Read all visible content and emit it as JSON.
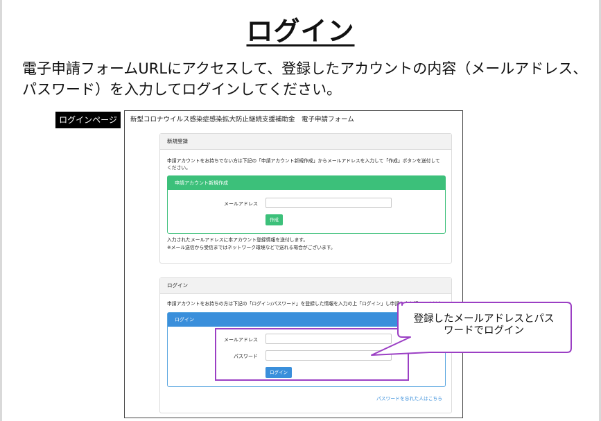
{
  "slide": {
    "title": "ログイン",
    "instruction": "電子申請フォームURLにアクセスして、登録したアカウントの内容（メールアドレス、パスワード）を入力してログインしてください。"
  },
  "page_label": "ログインページ",
  "form": {
    "header_title": "新型コロナウイルス感染症感染拡大防止継続支援補助金　電子申請フォーム",
    "register": {
      "heading": "新規登録",
      "description": "申請アカウントをお持ちでない方は下記の「申請アカウント新規作成」からメールアドレスを入力して「作成」ボタンを送付してください。",
      "panel_title": "申請アカウント新規作成",
      "email_label": "メールアドレス",
      "email_value": "",
      "create_button": "作成",
      "note_line1": "入力されたメールアドレスに本アカウント登録情報を送付します。",
      "note_line2": "※メール送信から受信まではネットワーク環境などで送れる場合がございます。"
    },
    "login": {
      "heading": "ログイン",
      "description": "申請アカウントをお持ちの方は下記の「ログイン/パスワード」を登録した情報を入力の上「ログイン」し申請入力を行ってください。",
      "panel_title": "ログイン",
      "email_label": "メールアドレス",
      "email_value": "",
      "password_label": "パスワード",
      "password_value": "",
      "login_button": "ログイン",
      "forgot_link": "パスワードを忘れた人はこちら"
    }
  },
  "callout": {
    "line1": "登録したメールアドレスとパス",
    "line2": "ワードでログイン"
  },
  "colors": {
    "green": "#3cc07a",
    "blue": "#3a8fdb",
    "highlight": "#9b3fc4"
  }
}
